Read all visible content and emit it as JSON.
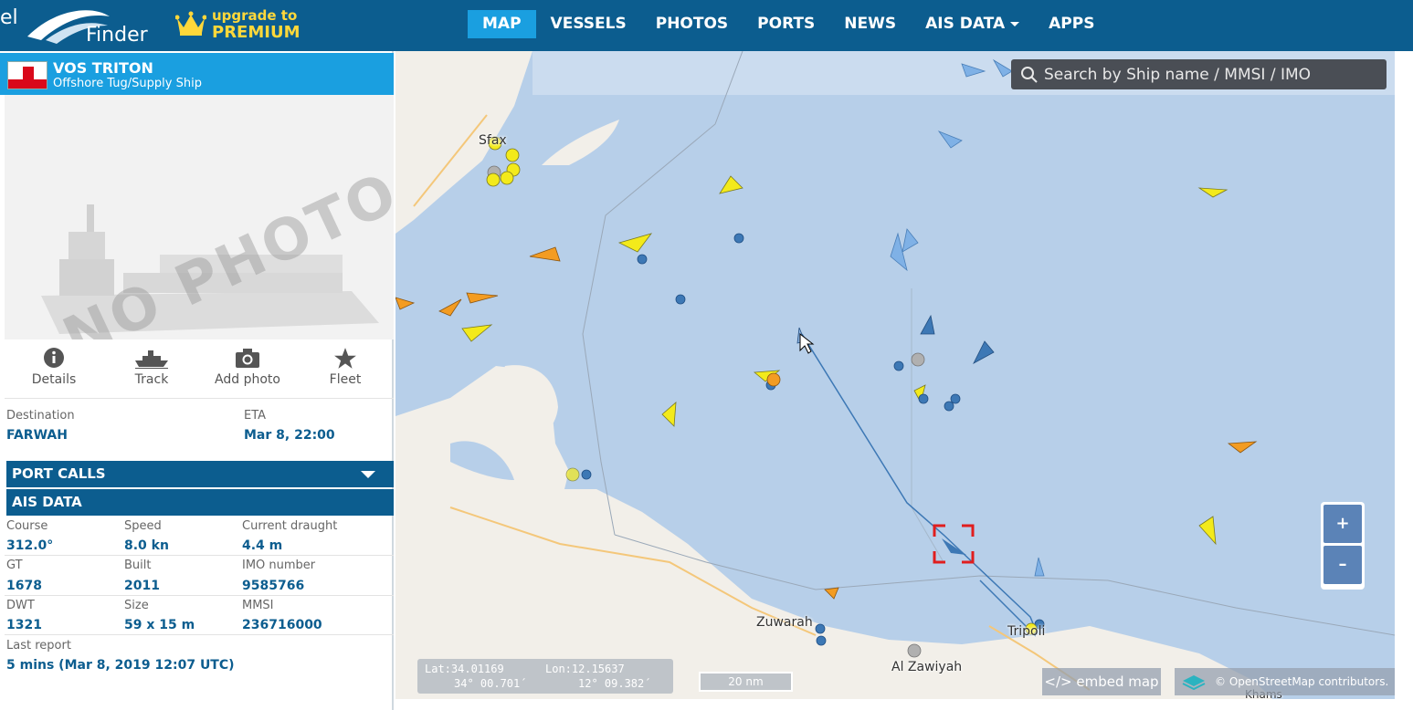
{
  "brand": {
    "logo_left": "el",
    "logo_right": "Finder",
    "premium_top": "upgrade to",
    "premium_bottom": "PREMIUM",
    "premium_color": "#ffd83a"
  },
  "nav": {
    "items": [
      {
        "label": "MAP",
        "active": true
      },
      {
        "label": "VESSELS"
      },
      {
        "label": "PHOTOS"
      },
      {
        "label": "PORTS"
      },
      {
        "label": "NEWS"
      },
      {
        "label": "AIS DATA",
        "dropdown": true
      },
      {
        "label": "APPS"
      }
    ],
    "bar_color": "#0c5d8f",
    "active_color": "#1a9fe0"
  },
  "vessel": {
    "name": "VOS TRITON",
    "type": "Offshore Tug/Supply Ship",
    "flag_icon": "gibraltar-flag-icon",
    "photo_placeholder": "NO PHOTO"
  },
  "actions": [
    {
      "label": "Details",
      "icon": "info-icon"
    },
    {
      "label": "Track",
      "icon": "ship-icon"
    },
    {
      "label": "Add photo",
      "icon": "camera-icon"
    },
    {
      "label": "Fleet",
      "icon": "star-icon"
    }
  ],
  "voyage": {
    "destination_label": "Destination",
    "destination": "FARWAH",
    "eta_label": "ETA",
    "eta": "Mar 8, 22:00"
  },
  "sections": {
    "port_calls": "PORT CALLS",
    "ais_data": "AIS DATA"
  },
  "ais": {
    "course_label": "Course",
    "course": "312.0°",
    "speed_label": "Speed",
    "speed": "8.0 kn",
    "draught_label": "Current draught",
    "draught": "4.4 m",
    "gt_label": "GT",
    "gt": "1678",
    "built_label": "Built",
    "built": "2011",
    "imo_label": "IMO number",
    "imo": "9585766",
    "dwt_label": "DWT",
    "dwt": "1321",
    "size_label": "Size",
    "size": "59 x 15 m",
    "mmsi_label": "MMSI",
    "mmsi": "236716000",
    "last_report_label": "Last report",
    "last_report": "5 mins (Mar 8, 2019 12:07 UTC)"
  },
  "map": {
    "search_placeholder": "Search by Ship name / MMSI / IMO",
    "zoom_in": "+",
    "zoom_out": "–",
    "lat": "Lat:34.01169",
    "lon": "Lon:12.15637",
    "lat_dms": "34° 00.701´",
    "lon_dms": "12° 09.382´",
    "scale": "20 nm",
    "embed": "</> embed map",
    "attribution": "© OpenStreetMap contributors.",
    "places": [
      "Sfax",
      "Zuwarah",
      "Tripoli",
      "Al Zawiyah",
      "Khams"
    ],
    "sea_color": "#b7cfe9",
    "land_color": "#f2efe9"
  }
}
